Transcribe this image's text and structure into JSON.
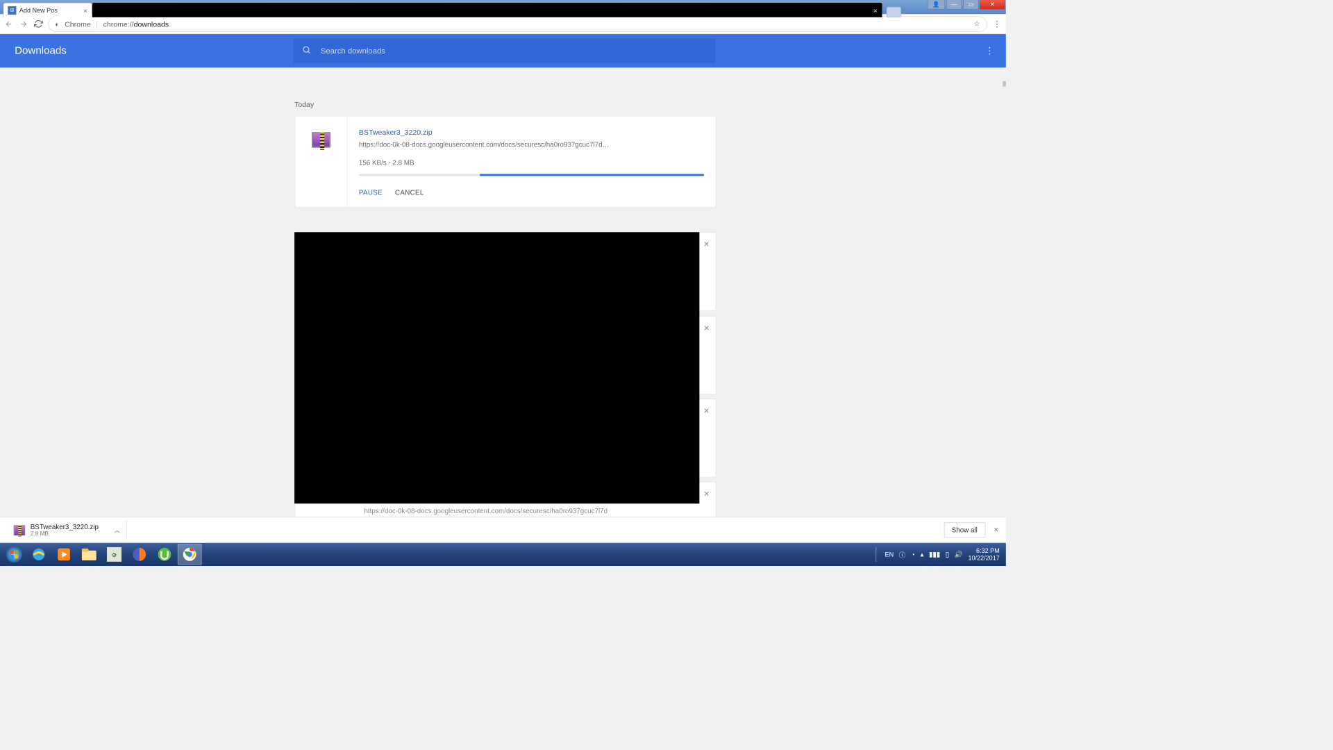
{
  "window": {
    "tab_title": "Add New Pos"
  },
  "addressbar": {
    "scheme_label": "Chrome",
    "url_prefix": "chrome://",
    "url_bold": "downloads"
  },
  "header": {
    "title": "Downloads",
    "search_placeholder": "Search downloads"
  },
  "section_label": "Today",
  "download": {
    "filename": "BSTweaker3_3220.zip",
    "url": "https://doc-0k-08-docs.googleusercontent.com/docs/securesc/ha0ro937gcuc7l7d…",
    "status": "156 KB/s - 2.8 MB",
    "pause": "PAUSE",
    "cancel": "CANCEL"
  },
  "ghost_url": "https://doc-0k-08-docs.googleusercontent.com/docs/securesc/ha0ro937gcuc7l7d",
  "shelf": {
    "item_name": "BSTweaker3_3220.zip",
    "item_size": "2.8 MB",
    "show_all": "Show all"
  },
  "tray": {
    "lang": "EN",
    "time": "6:32 PM",
    "date": "10/22/2017"
  }
}
